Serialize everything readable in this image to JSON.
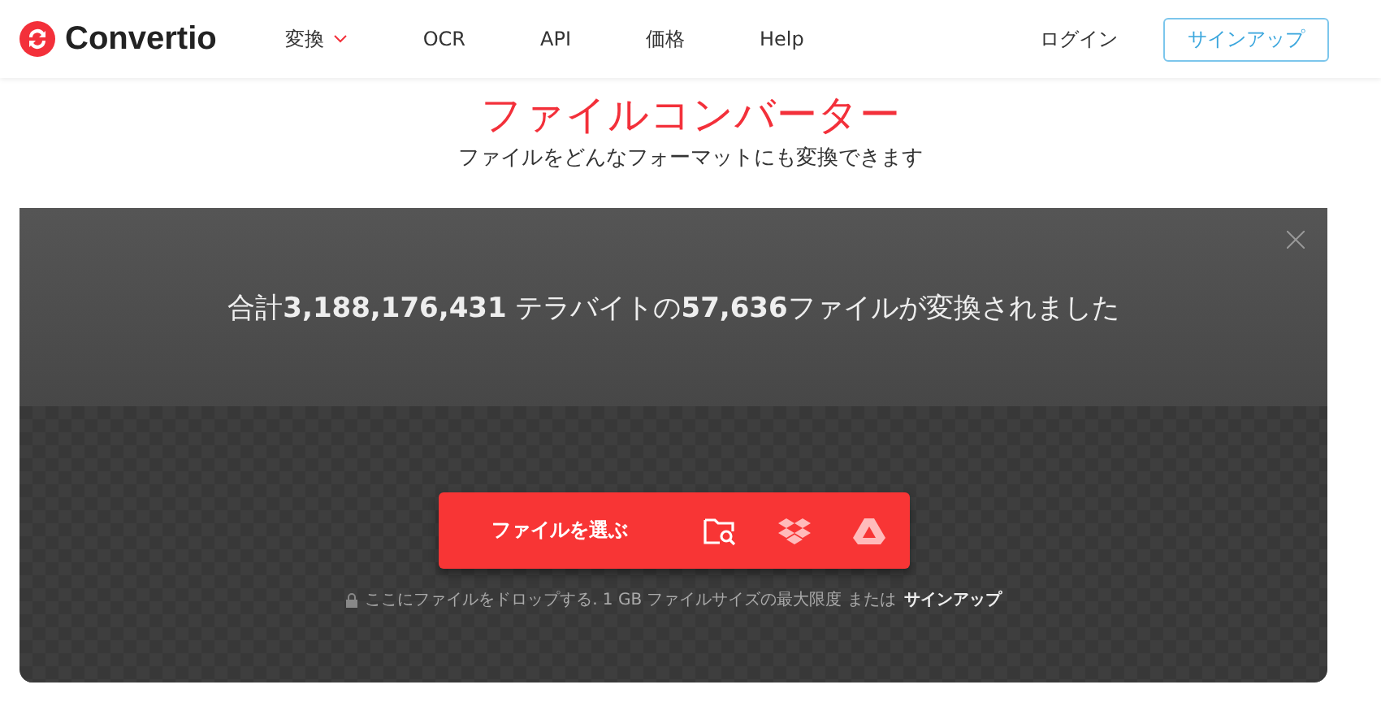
{
  "header": {
    "logo": "Convertio",
    "nav": [
      {
        "label": "変換",
        "kind": "dropdown"
      },
      {
        "label": "OCR",
        "kind": "link"
      },
      {
        "label": "API",
        "kind": "link"
      },
      {
        "label": "価格",
        "kind": "link"
      },
      {
        "label": "Help",
        "kind": "link"
      }
    ],
    "login": "ログイン",
    "signup": "サインアップ"
  },
  "hero": {
    "title": "ファイルコンバーター",
    "subtitle": "ファイルをどんなフォーマットにも変換できます"
  },
  "panel": {
    "stats": "合計**3,188,176,431** テラバイトの**57,636**ファイルが変換されました",
    "choose_button": "ファイルを選ぶ",
    "drop_hint": "ここにファイルをドロップする. 1 GB ファイルサイズの最大限度 または",
    "signup_link": "サインアップ"
  }
}
